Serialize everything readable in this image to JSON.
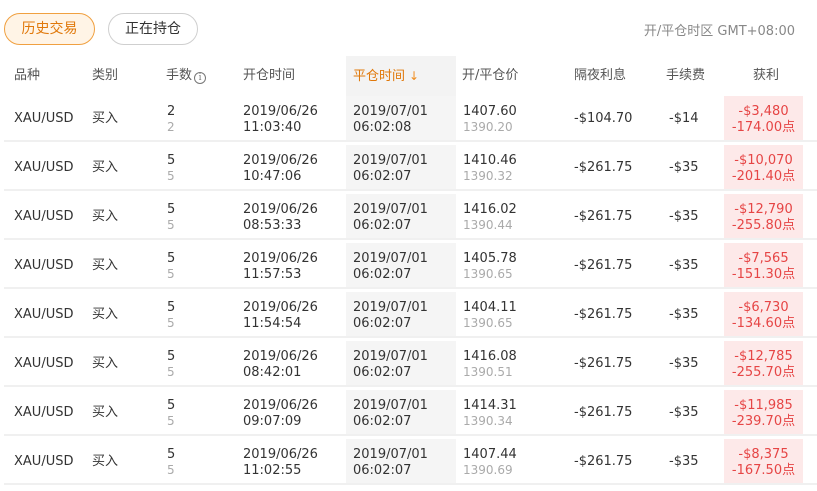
{
  "tabs": {
    "history": "历史交易",
    "positions": "正在持仓"
  },
  "timezone": "开/平仓时区 GMT+08:00",
  "columns": {
    "symbol": "品种",
    "type": "类别",
    "lots": "手数",
    "open_time": "开仓时间",
    "close_time": "平仓时间",
    "price": "开/平仓价",
    "swap": "隔夜利息",
    "commission": "手续费",
    "profit": "获利"
  },
  "colors": {
    "accent": "#f08c1c",
    "loss": "#e64545",
    "loss_bg": "#fde9e9"
  },
  "rows": [
    {
      "symbol": "XAU/USD",
      "type": "买入",
      "lots_open": "2",
      "lots_close": "2",
      "open_date": "2019/06/26",
      "open_clock": "11:03:40",
      "close_date": "2019/07/01",
      "close_clock": "06:02:08",
      "open_price": "1407.60",
      "close_price": "1390.20",
      "swap": "-$104.70",
      "commission": "-$14",
      "profit": "-$3,480",
      "points": "-174.00点"
    },
    {
      "symbol": "XAU/USD",
      "type": "买入",
      "lots_open": "5",
      "lots_close": "5",
      "open_date": "2019/06/26",
      "open_clock": "10:47:06",
      "close_date": "2019/07/01",
      "close_clock": "06:02:07",
      "open_price": "1410.46",
      "close_price": "1390.32",
      "swap": "-$261.75",
      "commission": "-$35",
      "profit": "-$10,070",
      "points": "-201.40点"
    },
    {
      "symbol": "XAU/USD",
      "type": "买入",
      "lots_open": "5",
      "lots_close": "5",
      "open_date": "2019/06/26",
      "open_clock": "08:53:33",
      "close_date": "2019/07/01",
      "close_clock": "06:02:07",
      "open_price": "1416.02",
      "close_price": "1390.44",
      "swap": "-$261.75",
      "commission": "-$35",
      "profit": "-$12,790",
      "points": "-255.80点"
    },
    {
      "symbol": "XAU/USD",
      "type": "买入",
      "lots_open": "5",
      "lots_close": "5",
      "open_date": "2019/06/26",
      "open_clock": "11:57:53",
      "close_date": "2019/07/01",
      "close_clock": "06:02:07",
      "open_price": "1405.78",
      "close_price": "1390.65",
      "swap": "-$261.75",
      "commission": "-$35",
      "profit": "-$7,565",
      "points": "-151.30点"
    },
    {
      "symbol": "XAU/USD",
      "type": "买入",
      "lots_open": "5",
      "lots_close": "5",
      "open_date": "2019/06/26",
      "open_clock": "11:54:54",
      "close_date": "2019/07/01",
      "close_clock": "06:02:07",
      "open_price": "1404.11",
      "close_price": "1390.65",
      "swap": "-$261.75",
      "commission": "-$35",
      "profit": "-$6,730",
      "points": "-134.60点"
    },
    {
      "symbol": "XAU/USD",
      "type": "买入",
      "lots_open": "5",
      "lots_close": "5",
      "open_date": "2019/06/26",
      "open_clock": "08:42:01",
      "close_date": "2019/07/01",
      "close_clock": "06:02:07",
      "open_price": "1416.08",
      "close_price": "1390.51",
      "swap": "-$261.75",
      "commission": "-$35",
      "profit": "-$12,785",
      "points": "-255.70点"
    },
    {
      "symbol": "XAU/USD",
      "type": "买入",
      "lots_open": "5",
      "lots_close": "5",
      "open_date": "2019/06/26",
      "open_clock": "09:07:09",
      "close_date": "2019/07/01",
      "close_clock": "06:02:07",
      "open_price": "1414.31",
      "close_price": "1390.34",
      "swap": "-$261.75",
      "commission": "-$35",
      "profit": "-$11,985",
      "points": "-239.70点"
    },
    {
      "symbol": "XAU/USD",
      "type": "买入",
      "lots_open": "5",
      "lots_close": "5",
      "open_date": "2019/06/26",
      "open_clock": "11:02:55",
      "close_date": "2019/07/01",
      "close_clock": "06:02:07",
      "open_price": "1407.44",
      "close_price": "1390.69",
      "swap": "-$261.75",
      "commission": "-$35",
      "profit": "-$8,375",
      "points": "-167.50点"
    }
  ]
}
